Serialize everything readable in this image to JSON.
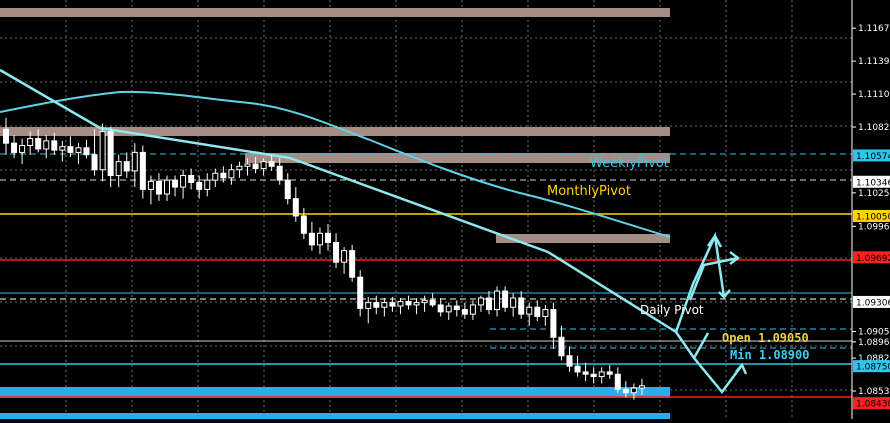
{
  "colors": {
    "background": "#000000",
    "grid": "#8a8a8a",
    "candle_up": "#ffffff",
    "candle_down": "#ffffff",
    "ma": "#5fd3e6",
    "trend": "#8ee8ef",
    "zone_brown": "#a58d85",
    "zone_blue": "#27aef0",
    "monthly": "#ffd400",
    "red": "#ff1a1a",
    "weekly_text": "#39c8e0",
    "monthly_text": "#ffd400",
    "daily_text": "#ffffff",
    "open_text": "#e8d24a",
    "min_text": "#38d0f0"
  },
  "axis": {
    "ticks": [
      "1.11675",
      "1.11390",
      "1.11105",
      "1.10820",
      "1.10250",
      "1.09960",
      "1.09050",
      "1.08960",
      "1.08820",
      "1.08535"
    ],
    "tags": [
      {
        "label": "1.10574",
        "color": "#2ec4ec"
      },
      {
        "label": "1.10346",
        "color": "#ffffff"
      },
      {
        "label": "1.10050",
        "color": "#ffd400"
      },
      {
        "label": "1.09692",
        "color": "#ff2020"
      },
      {
        "label": "1.09306",
        "color": "#ffffff"
      },
      {
        "label": "1.08750",
        "color": "#2ec4ec"
      },
      {
        "label": "1.08430",
        "color": "#ff2020"
      }
    ]
  },
  "labels": {
    "weekly_pivot": "WeeklyPivot",
    "monthly_pivot": "MonthlyPivot",
    "daily_pivot": "Daily Pivot",
    "open": "Open 1.09050",
    "min": "Min 1.08900"
  },
  "chart_data": {
    "type": "candlestick",
    "candles": [
      [
        1.108,
        1.109,
        1.1058,
        1.1068
      ],
      [
        1.1068,
        1.1075,
        1.1055,
        1.106
      ],
      [
        1.106,
        1.1072,
        1.105,
        1.1066
      ],
      [
        1.1066,
        1.1078,
        1.1058,
        1.1072
      ],
      [
        1.1072,
        1.108,
        1.106,
        1.1063
      ],
      [
        1.1063,
        1.1075,
        1.1055,
        1.107
      ],
      [
        1.107,
        1.1077,
        1.1058,
        1.1062
      ],
      [
        1.1062,
        1.107,
        1.1052,
        1.1065
      ],
      [
        1.1065,
        1.1074,
        1.1056,
        1.106
      ],
      [
        1.106,
        1.1068,
        1.105,
        1.1064
      ],
      [
        1.1064,
        1.1071,
        1.1055,
        1.1058
      ],
      [
        1.1058,
        1.108,
        1.104,
        1.1045
      ],
      [
        1.1045,
        1.1085,
        1.1035,
        1.1078
      ],
      [
        1.1078,
        1.1082,
        1.103,
        1.104
      ],
      [
        1.104,
        1.1058,
        1.103,
        1.1052
      ],
      [
        1.1052,
        1.106,
        1.1038,
        1.1044
      ],
      [
        1.1044,
        1.1068,
        1.103,
        1.106
      ],
      [
        1.106,
        1.1066,
        1.102,
        1.1028
      ],
      [
        1.1028,
        1.104,
        1.1015,
        1.1035
      ],
      [
        1.1035,
        1.1042,
        1.1018,
        1.1024
      ],
      [
        1.1024,
        1.104,
        1.1018,
        1.1036
      ],
      [
        1.1036,
        1.104,
        1.1022,
        1.103
      ],
      [
        1.103,
        1.1045,
        1.102,
        1.104
      ],
      [
        1.104,
        1.1046,
        1.1028,
        1.1034
      ],
      [
        1.1034,
        1.104,
        1.102,
        1.1028
      ],
      [
        1.1028,
        1.1042,
        1.1022,
        1.1036
      ],
      [
        1.1036,
        1.1046,
        1.103,
        1.1042
      ],
      [
        1.1042,
        1.1048,
        1.1034,
        1.1038
      ],
      [
        1.1038,
        1.105,
        1.1032,
        1.1045
      ],
      [
        1.1045,
        1.1052,
        1.1038,
        1.1048
      ],
      [
        1.1048,
        1.1055,
        1.104,
        1.105
      ],
      [
        1.105,
        1.1056,
        1.1042,
        1.1046
      ],
      [
        1.1046,
        1.1055,
        1.104,
        1.1052
      ],
      [
        1.1052,
        1.1058,
        1.1044,
        1.1048
      ],
      [
        1.1048,
        1.1055,
        1.1032,
        1.1036
      ],
      [
        1.1036,
        1.1042,
        1.1015,
        1.102
      ],
      [
        1.102,
        1.103,
        1.1,
        1.1005
      ],
      [
        1.1005,
        1.1012,
        1.0985,
        1.099
      ],
      [
        1.099,
        1.1,
        1.0975,
        1.098
      ],
      [
        1.098,
        1.0995,
        1.0972,
        1.099
      ],
      [
        1.099,
        1.0998,
        1.0975,
        1.0982
      ],
      [
        1.0982,
        1.099,
        1.096,
        1.0965
      ],
      [
        1.0965,
        1.0978,
        1.0955,
        1.0975
      ],
      [
        1.0975,
        1.098,
        1.0948,
        1.0952
      ],
      [
        1.0952,
        1.0958,
        1.0918,
        1.0925
      ],
      [
        1.0925,
        1.0935,
        1.0912,
        1.093
      ],
      [
        1.093,
        1.0936,
        1.092,
        1.0926
      ],
      [
        1.0926,
        1.0934,
        1.0918,
        1.093
      ],
      [
        1.093,
        1.0935,
        1.0922,
        1.0927
      ],
      [
        1.0927,
        1.0934,
        1.092,
        1.0931
      ],
      [
        1.0931,
        1.0936,
        1.0924,
        1.0928
      ],
      [
        1.0928,
        1.0934,
        1.092,
        1.093
      ],
      [
        1.093,
        1.0936,
        1.0922,
        1.0932
      ],
      [
        1.0932,
        1.0938,
        1.0926,
        1.0928
      ],
      [
        1.0928,
        1.0934,
        1.0918,
        1.0922
      ],
      [
        1.0922,
        1.093,
        1.0915,
        1.0927
      ],
      [
        1.0927,
        1.0932,
        1.0918,
        1.0924
      ],
      [
        1.0924,
        1.093,
        1.0916,
        1.092
      ],
      [
        1.092,
        1.0932,
        1.0915,
        1.0928
      ],
      [
        1.0928,
        1.0936,
        1.0922,
        1.0934
      ],
      [
        1.0934,
        1.094,
        1.092,
        1.0924
      ],
      [
        1.0924,
        1.0944,
        1.0918,
        1.094
      ],
      [
        1.094,
        1.0944,
        1.0922,
        1.0926
      ],
      [
        1.0926,
        1.0938,
        1.0918,
        1.0934
      ],
      [
        1.0934,
        1.094,
        1.0916,
        1.092
      ],
      [
        1.092,
        1.093,
        1.091,
        1.0926
      ],
      [
        1.0926,
        1.0932,
        1.0914,
        1.0918
      ],
      [
        1.0918,
        1.0928,
        1.091,
        1.0924
      ],
      [
        1.0924,
        1.093,
        1.089,
        1.09
      ],
      [
        1.09,
        1.091,
        1.088,
        1.0884
      ],
      [
        1.0884,
        1.0892,
        1.087,
        1.0875
      ],
      [
        1.0875,
        1.0884,
        1.0866,
        1.087
      ],
      [
        1.087,
        1.0878,
        1.0862,
        1.0868
      ],
      [
        1.0868,
        1.0874,
        1.086,
        1.0866
      ],
      [
        1.0866,
        1.0874,
        1.086,
        1.087
      ],
      [
        1.087,
        1.0876,
        1.0864,
        1.0868
      ],
      [
        1.0868,
        1.0874,
        1.0852,
        1.0855
      ],
      [
        1.0855,
        1.0862,
        1.0848,
        1.0852
      ],
      [
        1.0852,
        1.086,
        1.0846,
        1.0856
      ],
      [
        1.0856,
        1.0864,
        1.085,
        1.0858
      ]
    ]
  }
}
